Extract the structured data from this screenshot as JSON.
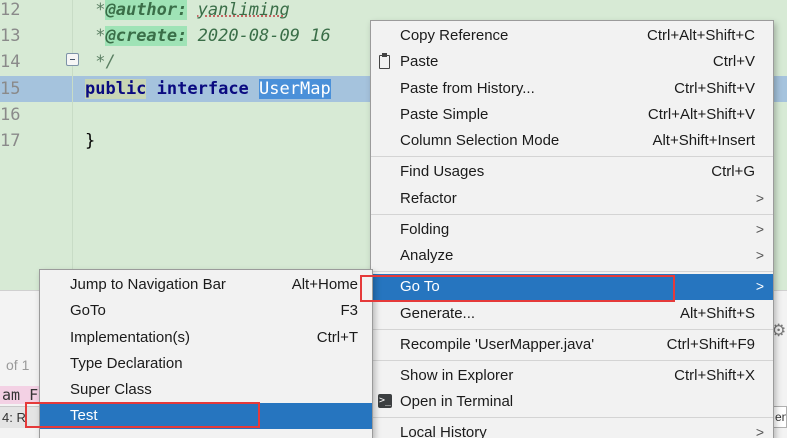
{
  "editor": {
    "lines": [
      {
        "num": "12",
        "prefix": " *",
        "tag": "@author:",
        "value": "yanliming"
      },
      {
        "num": "13",
        "prefix": " *",
        "tag": "@create:",
        "value": "2020-08-09 16"
      },
      {
        "num": "14",
        "text": " */"
      },
      {
        "num": "15",
        "kw1": "public",
        "kw2": "interface",
        "name": "UserMap"
      },
      {
        "num": "16",
        "text": ""
      },
      {
        "num": "17",
        "text": "}"
      }
    ]
  },
  "tool_window": {
    "of_label": "of 1",
    "am_label": "am F",
    "tab_label": "4: R",
    "right_tab": "ent"
  },
  "context_menu": {
    "items": [
      {
        "label": "Copy Reference",
        "shortcut": "Ctrl+Alt+Shift+C"
      },
      {
        "label": "Paste",
        "shortcut": "Ctrl+V",
        "icon": "clipboard-icon"
      },
      {
        "label": "Paste from History...",
        "shortcut": "Ctrl+Shift+V"
      },
      {
        "label": "Paste Simple",
        "shortcut": "Ctrl+Alt+Shift+V"
      },
      {
        "label": "Column Selection Mode",
        "shortcut": "Alt+Shift+Insert"
      },
      {
        "label": "Find Usages",
        "shortcut": "Ctrl+G"
      },
      {
        "label": "Refactor",
        "shortcut": ""
      },
      {
        "label": "Folding",
        "shortcut": ""
      },
      {
        "label": "Analyze",
        "shortcut": ""
      },
      {
        "label": "Go To",
        "shortcut": ""
      },
      {
        "label": "Generate...",
        "shortcut": "Alt+Shift+S"
      },
      {
        "label": "Recompile 'UserMapper.java'",
        "shortcut": "Ctrl+Shift+F9"
      },
      {
        "label": "Show in Explorer",
        "shortcut": "Ctrl+Shift+X"
      },
      {
        "label": "Open in Terminal",
        "shortcut": "",
        "icon": "terminal-icon"
      },
      {
        "label": "Local History",
        "shortcut": ""
      }
    ],
    "selected": "Go To"
  },
  "goto_submenu": {
    "items": [
      {
        "label": "Jump to Navigation Bar",
        "shortcut": "Alt+Home"
      },
      {
        "label": "GoTo",
        "shortcut": "F3"
      },
      {
        "label": "Implementation(s)",
        "shortcut": "Ctrl+T"
      },
      {
        "label": "Type Declaration",
        "shortcut": ""
      },
      {
        "label": "Super Class",
        "shortcut": ""
      },
      {
        "label": "Test",
        "shortcut": ""
      }
    ],
    "selected": "Test"
  },
  "colors": {
    "editor_bg": "#d7ead5",
    "highlight_row": "#a5c3dd",
    "menu_selected": "#2675bf",
    "annotation_box": "#e53a3a"
  }
}
